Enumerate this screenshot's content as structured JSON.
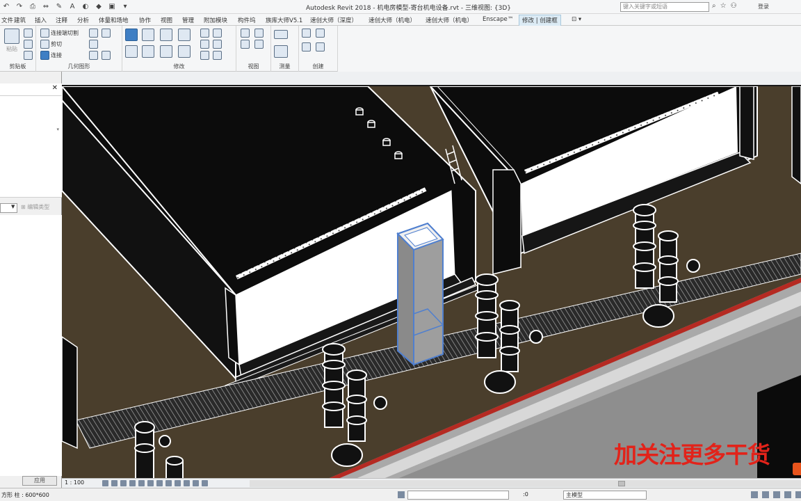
{
  "app": {
    "title": "Autodesk Revit 2018 -   机电房模型-寄台机电设备.rvt - 三维视图: {3D}",
    "search_placeholder": "键入关键字或短语",
    "signin": "登录"
  },
  "menu": {
    "tabs": [
      "文件",
      "建筑",
      "插入",
      "注释",
      "分析",
      "体量和场地",
      "协作",
      "视图",
      "管理",
      "附加模块",
      "构件坞",
      "族库大师V5.1",
      "速创大师（深度）",
      "速创大师（机电）",
      "速创大师（机电）",
      "Enscape™",
      "修改 | 创建框"
    ],
    "active_tab": "修改 | 创建框"
  },
  "ribbon": {
    "panels": [
      {
        "label": "剪贴板"
      },
      {
        "label": "几何图形",
        "items": [
          "连接端切割",
          "剪切",
          "连接"
        ]
      },
      {
        "label": "修改"
      },
      {
        "label": "视图"
      },
      {
        "label": "测量"
      },
      {
        "label": "创建"
      }
    ],
    "paste_label": "粘贴"
  },
  "properties": {
    "edit_type": "编辑类型",
    "apply": "应用"
  },
  "viewport": {
    "watermark": "加关注更多干货",
    "accent_color": "#e2231a",
    "selection_color": "#4f7fcf",
    "floor_color": "#4a3e2c"
  },
  "viewbar": {
    "scale": "1 : 100"
  },
  "status": {
    "text": "方形 柱 : 600*600",
    "zero": ":0",
    "model": "主模型"
  }
}
